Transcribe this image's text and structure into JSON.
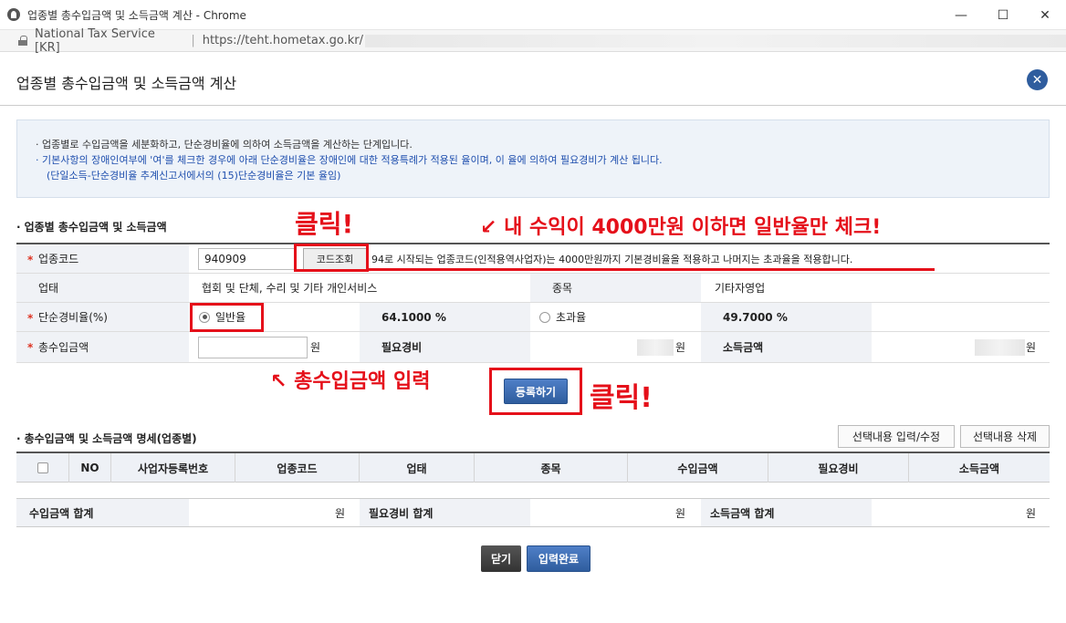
{
  "window": {
    "title": "업종별 총수입금액 및 소득금액 계산 - Chrome",
    "site_label": "National Tax Service [KR]",
    "url": "https://teht.hometax.go.kr/",
    "minimize": "—",
    "maximize": "☐",
    "close": "✕"
  },
  "modal": {
    "title": "업종별 총수입금액 및 소득금액 계산",
    "close_icon": "✕"
  },
  "info": {
    "line1": "· 업종별로 수입금액을 세분화하고, 단순경비율에 의하여 소득금액을 계산하는 단계입니다.",
    "line2": "· 기본사항의 장애인여부에 '여'를 체크한 경우에 아래 단순경비율은 장애인에 대한 적용특례가 적용된 율이며, 이 율에 의하여 필요경비가 계산 됩니다.",
    "line3": "(단일소득-단순경비율 추계신고서에서의 (15)단순경비율은 기본 율임)"
  },
  "section1": {
    "title": "업종별 총수입금액 및 소득금액",
    "industry_code_label": "업종코드",
    "industry_code_value": "940909",
    "code_lookup_button": "코드조회",
    "code_note": "94로 시작되는 업종코드(인적용역사업자)는 4000만원까지 기본경비율을 적용하고 나머지는 초과율을 적용합니다.",
    "business_type_label": "업태",
    "business_type_value": "협회 및 단체, 수리 및 기타 개인서비스",
    "category_label": "종목",
    "category_value": "기타자영업",
    "simple_rate_label": "단순경비율(%)",
    "general_rate_label": "일반율",
    "general_rate_value": "64.1000 %",
    "excess_rate_label": "초과율",
    "excess_rate_value": "49.7000 %",
    "total_income_label": "총수입금액",
    "won": "원",
    "required_expense_label": "필요경비",
    "income_amount_label": "소득금액",
    "register_button": "등록하기"
  },
  "section2": {
    "title": "총수입금액 및 소득금액 명세(업종별)",
    "edit_button": "선택내용 입력/수정",
    "delete_button": "선택내용 삭제",
    "columns": [
      "NO",
      "사업자등록번호",
      "업종코드",
      "업태",
      "종목",
      "수입금액",
      "필요경비",
      "소득금액"
    ],
    "sum_income_label": "수입금액 합계",
    "sum_expense_label": "필요경비 합계",
    "sum_profit_label": "소득금액 합계",
    "won": "원"
  },
  "footer": {
    "close_button": "닫기",
    "complete_button": "입력완료"
  },
  "annotations": {
    "click1": "클릭!",
    "check_note": "↙ 내 수익이 4000만원 이하면 일반율만 체크!",
    "input_note": "↖ 총수입금액 입력",
    "click2": "클릭!",
    "color": "#e5101a"
  }
}
